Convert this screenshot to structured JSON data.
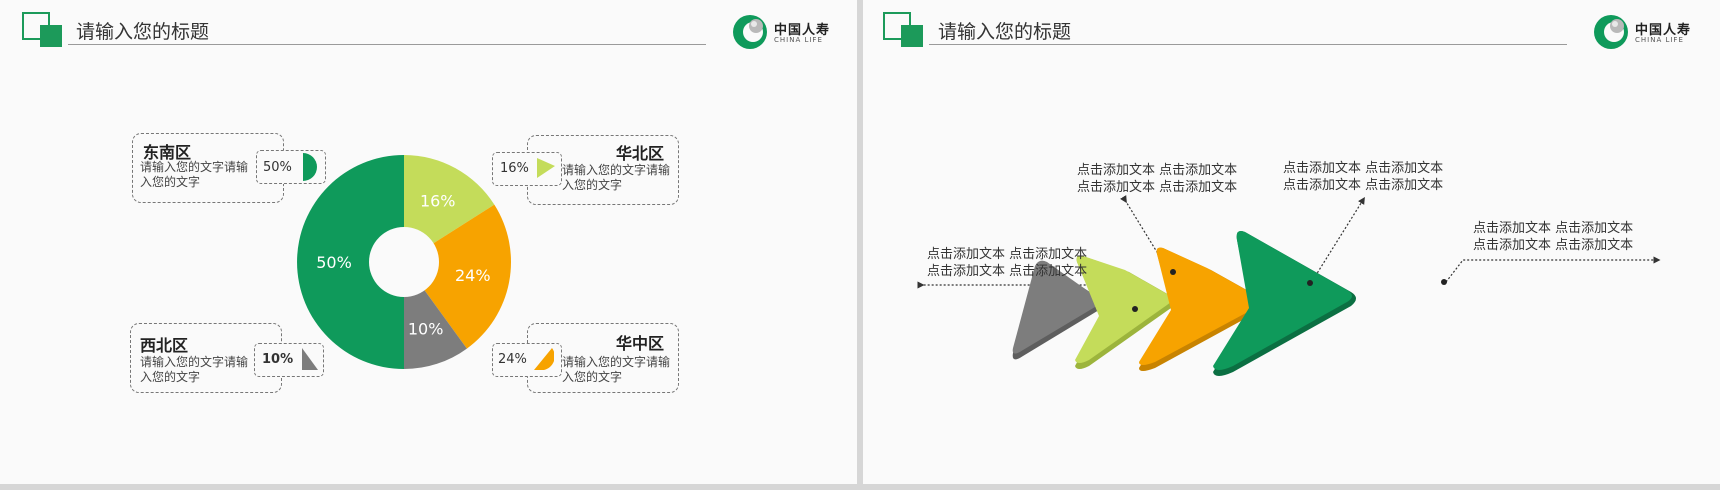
{
  "slides": [
    {
      "header": {
        "title": "请输入您的标题"
      },
      "logo": {
        "cn": "中国人寿",
        "en": "CHINA LIFE"
      },
      "chart_data": {
        "type": "pie",
        "categories": [
          "东南区",
          "华北区",
          "华中区",
          "西北区"
        ],
        "values": [
          50,
          16,
          24,
          10
        ],
        "slice_labels": [
          "50%",
          "16%",
          "24%",
          "10%"
        ],
        "colors": [
          "#0f9a5b",
          "#c4dc5a",
          "#f7a300",
          "#7d7d7d"
        ],
        "donut": true
      },
      "regions": [
        {
          "name": "东南区",
          "desc": "请输入您的文字请输入您的文字",
          "pct": "50%",
          "color": "#0f9a5b"
        },
        {
          "name": "华北区",
          "desc": "请输入您的文字请输入您的文字",
          "pct": "16%",
          "color": "#c4dc5a"
        },
        {
          "name": "西北区",
          "desc": "请输入您的文字请输入您的文字",
          "pct": "10%",
          "color": "#7d7d7d"
        },
        {
          "name": "华中区",
          "desc": "请输入您的文字请输入您的文字",
          "pct": "24%",
          "color": "#f7a300"
        }
      ]
    },
    {
      "header": {
        "title": "请输入您的标题"
      },
      "logo": {
        "cn": "中国人寿",
        "en": "CHINA LIFE"
      },
      "captions": [
        {
          "line1": "点击添加文本  点击添加文本",
          "line2": "点击添加文本  点击添加文本"
        },
        {
          "line1": "点击添加文本  点击添加文本",
          "line2": "点击添加文本  点击添加文本"
        },
        {
          "line1": "点击添加文本  点击添加文本",
          "line2": "点击添加文本  点击添加文本"
        },
        {
          "line1": "点击添加文本  点击添加文本",
          "line2": "点击添加文本  点击添加文本"
        }
      ],
      "arrow_colors": [
        "#7d7d7d",
        "#c4dc5a",
        "#f7a300",
        "#0f9a5b"
      ]
    }
  ]
}
